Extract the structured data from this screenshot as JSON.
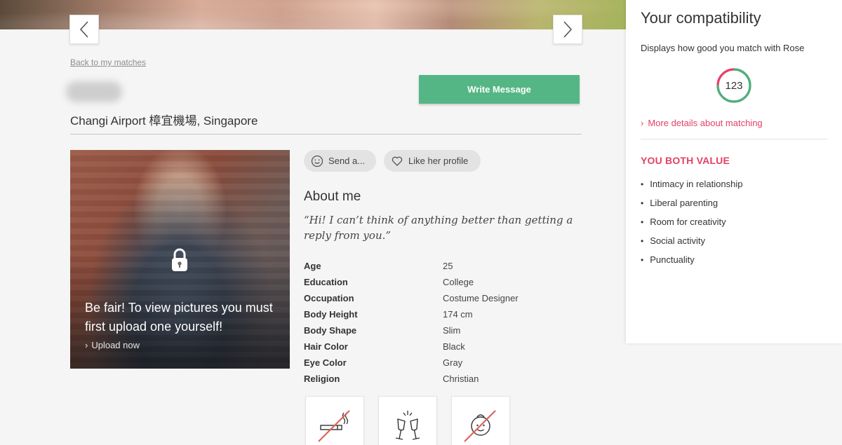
{
  "nav": {
    "back_link": "Back to my matches"
  },
  "profile": {
    "location": "Changi Airport 樟宜機場, Singapore",
    "write_message": "Write Message",
    "photo_locked_text": "Be fair! To view pictures you must first upload one yourself!",
    "upload_link": "Upload now"
  },
  "actions": {
    "send": "Send a...",
    "like": "Like her profile"
  },
  "about": {
    "heading": "About me",
    "quote": "“Hi! I can’t think of anything better than getting a reply from you.”",
    "details": [
      {
        "label": "Age",
        "value": "25"
      },
      {
        "label": "Education",
        "value": "College"
      },
      {
        "label": "Occupation",
        "value": "Costume Designer"
      },
      {
        "label": "Body Height",
        "value": "174 cm"
      },
      {
        "label": "Body Shape",
        "value": "Slim"
      },
      {
        "label": "Hair Color",
        "value": "Black"
      },
      {
        "label": "Eye Color",
        "value": "Gray"
      },
      {
        "label": "Religion",
        "value": "Christian"
      }
    ],
    "lifestyle_icons": [
      "no-smoking-icon",
      "champagne-icon",
      "no-children-icon"
    ]
  },
  "compatibility": {
    "title": "Your compatibility",
    "subtitle": "Displays how good you match with Rose",
    "score": "123",
    "ring_fraction": 0.75,
    "more_link": "More details about matching",
    "values_heading": "YOU BOTH VALUE",
    "values": [
      "Intimacy in relationship",
      "Liberal parenting",
      "Room for creativity",
      "Social activity",
      "Punctuality"
    ]
  },
  "colors": {
    "accent_pink": "#e44166",
    "accent_green": "#55b685",
    "ring_green": "#49b37c"
  }
}
